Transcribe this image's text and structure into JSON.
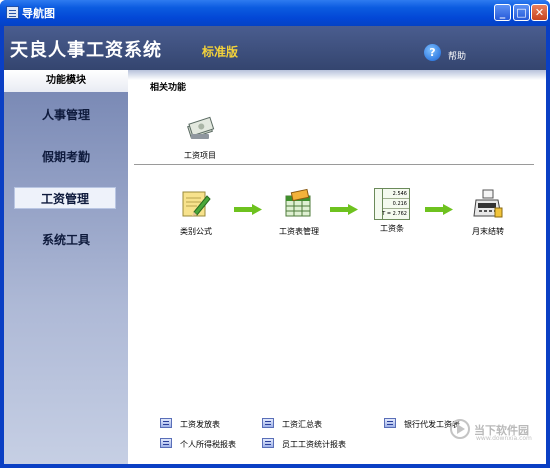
{
  "window": {
    "title": "导航图"
  },
  "titlebar_buttons": {
    "minimize": "_",
    "maximize": "□",
    "close": "✕"
  },
  "header": {
    "app_title": "天良人事工资系统",
    "edition": "标准版",
    "help_label": "帮助",
    "help_icon": "?"
  },
  "sidebar": {
    "heading": "功能模块",
    "items": [
      {
        "label": "人事管理",
        "active": false
      },
      {
        "label": "假期考勤",
        "active": false
      },
      {
        "label": "工资管理",
        "active": true
      },
      {
        "label": "系统工具",
        "active": false
      }
    ]
  },
  "main": {
    "section_title": "相关功能",
    "top_item": {
      "label": "工资项目",
      "icon": "money-icon"
    },
    "workflow": [
      {
        "label": "类别公式",
        "icon": "formula-edit-icon"
      },
      {
        "label": "工资表管理",
        "icon": "spreadsheet-icon"
      },
      {
        "label": "工资条",
        "icon": "payslip-icon"
      },
      {
        "label": "月末结转",
        "icon": "cash-register-icon"
      }
    ],
    "payslip_values": [
      "2.546",
      "0.216",
      "T = 2.762"
    ],
    "bottom_links": [
      {
        "label": "工资发放表"
      },
      {
        "label": "工资汇总表"
      },
      {
        "label": "银行代发工资表"
      },
      {
        "label": "个人所得税报表"
      },
      {
        "label": "员工工资统计报表"
      }
    ]
  },
  "watermark": {
    "text": "当下软件园",
    "url": "www.downxia.com"
  },
  "colors": {
    "titlebar": "#0b5be0",
    "header": "#3f5180",
    "sidebar": "#8e9cc4",
    "arrow": "#6ec21f",
    "edition": "#f3d23a"
  }
}
